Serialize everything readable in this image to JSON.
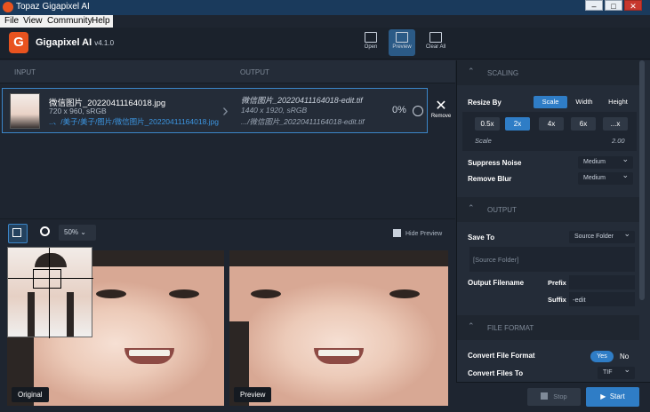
{
  "window": {
    "title": "Topaz Gigapixel AI",
    "minimize": "–",
    "maximize": "□",
    "close": "✕"
  },
  "menu": [
    "File",
    "View",
    "Community",
    "Help"
  ],
  "header": {
    "app_name": "Gigapixel AI",
    "version": "v4.1.0",
    "tools": [
      {
        "label": "Open"
      },
      {
        "label": "Preview"
      },
      {
        "label": "Clear All"
      }
    ]
  },
  "columns": {
    "input": "INPUT",
    "output": "OUTPUT"
  },
  "file": {
    "name": "微信图片_20220411164018.jpg",
    "meta": "720 x 960, sRGB",
    "path": "..、/美子/美子/图片/微信图片_20220411164018.jpg",
    "output_name": "微信图片_20220411164018-edit.tif",
    "output_meta": "1440 x 1920, sRGB",
    "output_path": ".../微信图片_20220411164018-edit.tif",
    "progress": "0%",
    "remove_label": "Remove"
  },
  "preview": {
    "zoom": "50%",
    "hide_label": "Hide Preview",
    "original_label": "Original",
    "preview_label": "Preview"
  },
  "panel": {
    "scaling_title": "SCALING",
    "resize_by_label": "Resize By",
    "resize_modes": [
      "Scale",
      "Width",
      "Height"
    ],
    "scale_options": [
      "0.5x",
      "2x",
      "4x",
      "6x",
      "...x"
    ],
    "scale_label": "Scale",
    "scale_value": "2.00",
    "suppress_noise_label": "Suppress Noise",
    "suppress_noise_value": "Medium",
    "remove_blur_label": "Remove Blur",
    "remove_blur_value": "Medium",
    "output_title": "OUTPUT",
    "save_to_label": "Save To",
    "save_to_value": "Source Folder",
    "source_folder_text": "[Source Folder]",
    "output_filename_label": "Output Filename",
    "prefix_label": "Prefix",
    "prefix_value": "",
    "suffix_label": "Suffix",
    "suffix_value": "-edit",
    "file_format_title": "FILE FORMAT",
    "convert_format_label": "Convert File Format",
    "yes": "Yes",
    "no": "No",
    "convert_to_label": "Convert Files To",
    "convert_to_value": "TIF"
  },
  "footer": {
    "stop": "Stop",
    "start": "Start"
  },
  "colors": {
    "accent": "#2f7dc6",
    "brand": "#e8531f",
    "background": "#1e2530",
    "panel": "#242c38"
  }
}
